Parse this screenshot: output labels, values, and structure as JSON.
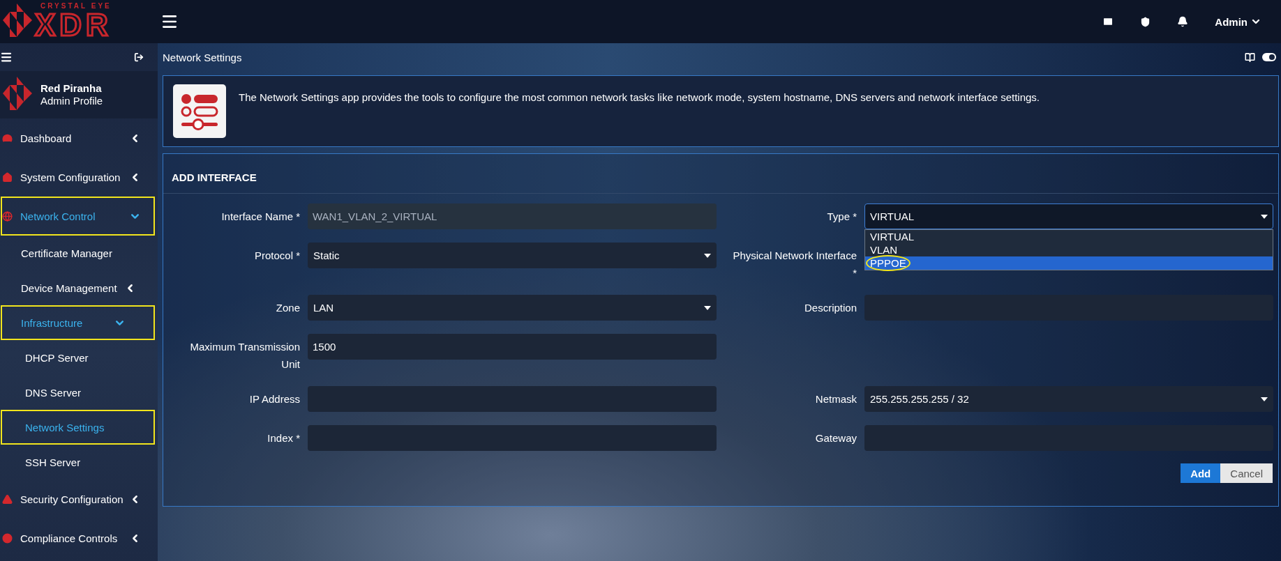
{
  "header": {
    "logo_top": "CRYSTAL EYE",
    "logo_main": "XDR",
    "user": "Admin"
  },
  "sidebar": {
    "profile": {
      "name": "Red Piranha",
      "role": "Admin Profile"
    },
    "items": [
      {
        "label": "Dashboard",
        "selected": false,
        "highlighted": false,
        "expanded": false
      },
      {
        "label": "System Configuration",
        "selected": false,
        "highlighted": false,
        "expanded": false
      },
      {
        "label": "Network Control",
        "selected": true,
        "highlighted": true,
        "expanded": true,
        "children": [
          {
            "label": "Certificate Manager",
            "selected": false,
            "highlighted": false
          },
          {
            "label": "Device Management",
            "selected": false,
            "highlighted": false,
            "expanded": false
          },
          {
            "label": "Infrastructure",
            "selected": true,
            "highlighted": true,
            "expanded": true,
            "children": [
              {
                "label": "DHCP Server",
                "selected": false,
                "highlighted": false
              },
              {
                "label": "DNS Server",
                "selected": false,
                "highlighted": false
              },
              {
                "label": "Network Settings",
                "selected": true,
                "highlighted": true
              },
              {
                "label": "SSH Server",
                "selected": false,
                "highlighted": false
              }
            ]
          }
        ]
      },
      {
        "label": "Security Configuration",
        "selected": false,
        "highlighted": false,
        "expanded": false
      },
      {
        "label": "Compliance Controls",
        "selected": false,
        "highlighted": false,
        "expanded": false
      }
    ]
  },
  "page": {
    "title": "Network Settings",
    "info": "The Network Settings app provides the tools to configure the most common network tasks like network mode, system hostname, DNS servers and network interface settings."
  },
  "form": {
    "title": "ADD INTERFACE",
    "rows": [
      {
        "left": {
          "label": "Interface Name *",
          "kind": "text",
          "value": "WAN1_VLAN_2_VIRTUAL",
          "disabled": true
        },
        "right": {
          "label": "Type *",
          "kind": "select",
          "value": "VIRTUAL",
          "expanded": true,
          "options": [
            {
              "label": "VIRTUAL",
              "highlighted": false,
              "circled": false
            },
            {
              "label": "VLAN",
              "highlighted": false,
              "circled": false
            },
            {
              "label": "PPPOE",
              "highlighted": true,
              "circled": true
            }
          ]
        }
      },
      {
        "left": {
          "label": "Protocol *",
          "kind": "select",
          "value": "Static",
          "expanded": false
        },
        "right": {
          "label": "Physical Network Interface *",
          "kind": "text"
        }
      },
      {
        "left": {
          "label": "Zone",
          "kind": "select",
          "value": "LAN",
          "expanded": false
        },
        "right": {
          "label": "Description",
          "kind": "text"
        }
      },
      {
        "left": {
          "label": "Maximum Transmission Unit",
          "kind": "text",
          "value": "1500",
          "disabled": false
        }
      },
      {
        "left": {
          "label": "IP Address",
          "kind": "text"
        },
        "right": {
          "label": "Netmask",
          "kind": "select",
          "value": "255.255.255.255 / 32",
          "expanded": false
        }
      },
      {
        "left": {
          "label": "Index *",
          "kind": "text"
        },
        "right": {
          "label": "Gateway",
          "kind": "text"
        }
      }
    ],
    "buttons": [
      {
        "label": "Add",
        "kind": "primary"
      },
      {
        "label": "Cancel",
        "kind": "secondary"
      }
    ]
  }
}
